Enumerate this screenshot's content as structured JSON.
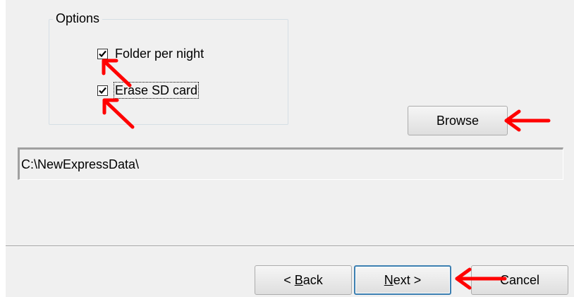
{
  "options_group": {
    "title": "Options",
    "folder_per_night": {
      "label": "Folder per night",
      "checked": true
    },
    "erase_sd_card": {
      "label": "Erase SD card",
      "checked": true
    }
  },
  "browse_button": {
    "label": "Browse"
  },
  "path_field": {
    "value": "C:\\NewExpressData\\"
  },
  "footer": {
    "back_label": "< Back",
    "next_label": "Next >",
    "cancel_label": "Cancel"
  },
  "annotation": {
    "arrow_color": "#ff0000",
    "arrow_icon": "red-arrow"
  },
  "colors": {
    "dialog_background": "#f0f0f0",
    "default_button_border": "#3c7fb1"
  }
}
